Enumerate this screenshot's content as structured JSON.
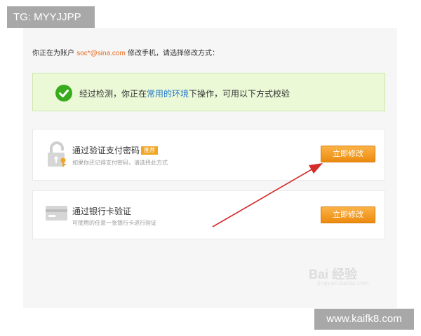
{
  "top_tag": "TG: MYYJJPP",
  "intro": {
    "prefix": "你正在为账户",
    "account": "soc*@sina.com",
    "suffix": "修改手机，请选择修改方式："
  },
  "notice": {
    "icon": "check-circle-icon",
    "text_before": "经过检测，你正在",
    "link": "常用的环境",
    "text_after": "下操作，可用以下方式校验"
  },
  "options": [
    {
      "icon": "lock-icon",
      "title": "通过验证支付密码",
      "badge": "推荐",
      "subtitle": "如果你还记得支付密码，请选择此方式",
      "button": "立即修改"
    },
    {
      "icon": "bank-card-icon",
      "title": "通过银行卡验证",
      "subtitle": "可使用的任意一张银行卡进行验证",
      "button": "立即修改"
    }
  ],
  "watermark": "Bai 经验",
  "watermark_sub": "jingyan.baidu.com",
  "footer_tag": "www.kaifk8.com",
  "colors": {
    "accent_orange": "#ec8b0e",
    "account_text": "#e7681e",
    "link_blue": "#2477c9",
    "notice_bg": "#ebf9d7",
    "check_green": "#39ac1e",
    "arrow_red": "#d42b2b"
  }
}
